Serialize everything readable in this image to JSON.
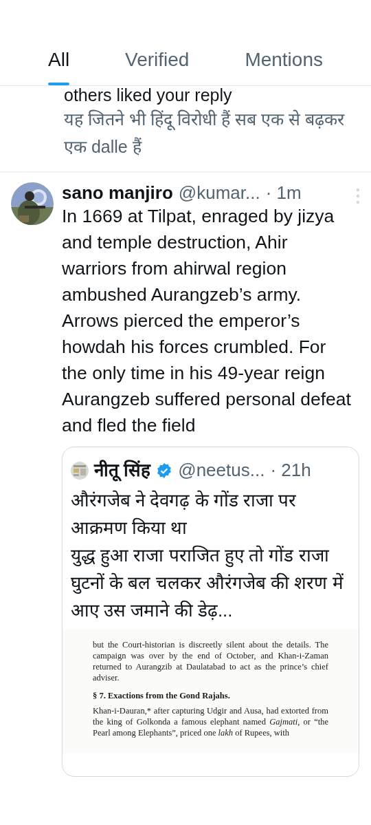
{
  "tabs": [
    {
      "label": "All",
      "selected": true
    },
    {
      "label": "Verified",
      "selected": false
    },
    {
      "label": "Mentions",
      "selected": false
    }
  ],
  "notification": {
    "summary": "others liked your reply",
    "reply_text": "यह जितने भी हिंदू विरोधी हैं सब एक से बढ़कर एक dalle हैं"
  },
  "post": {
    "display_name": "sano manjiro",
    "handle": "@kumar...",
    "time": "· 1m",
    "text": "In 1669 at Tilpat, enraged by jizya and temple destruction, Ahir warriors from ahirwal region ambushed Aurangzeb’s army. Arrows pierced the emperor’s howdah his forces crumbled. For the only time in his 49-year reign Aurangzeb suffered personal defeat and fled the field",
    "quote": {
      "display_name": "नीतू सिंह",
      "verified": true,
      "handle": "@neetus...",
      "time": "· 21h",
      "text": [
        "औरंगजेब ने देवगढ़ के गोंड राजा पर आक्रमण किया था",
        "युद्ध हुआ राजा पराजित हुए तो गोंड राजा घुटनों के बल चलकर औरंगजेब की शरण में आए उस जमाने की डेढ़..."
      ],
      "document": [
        {
          "kind": "paragraph",
          "text": "but the Court-historian is discreetly silent about the details. The campaign was over by the end of October, and Khan-i-Zaman returned to Aurangzib at Daulatabad to act as the prince’s chief adviser."
        },
        {
          "kind": "heading",
          "text": "§ 7. Exactions from the Gond Rajahs."
        },
        {
          "kind": "paragraph",
          "text": "Khan-i-Dauran,* after capturing Udgir and Ausa, had extorted from the king of Golkonda a famous elephant named *Gajmati*, or “the Pearl among Elephants”, priced one *lakh* of Rupees, with"
        }
      ]
    }
  }
}
